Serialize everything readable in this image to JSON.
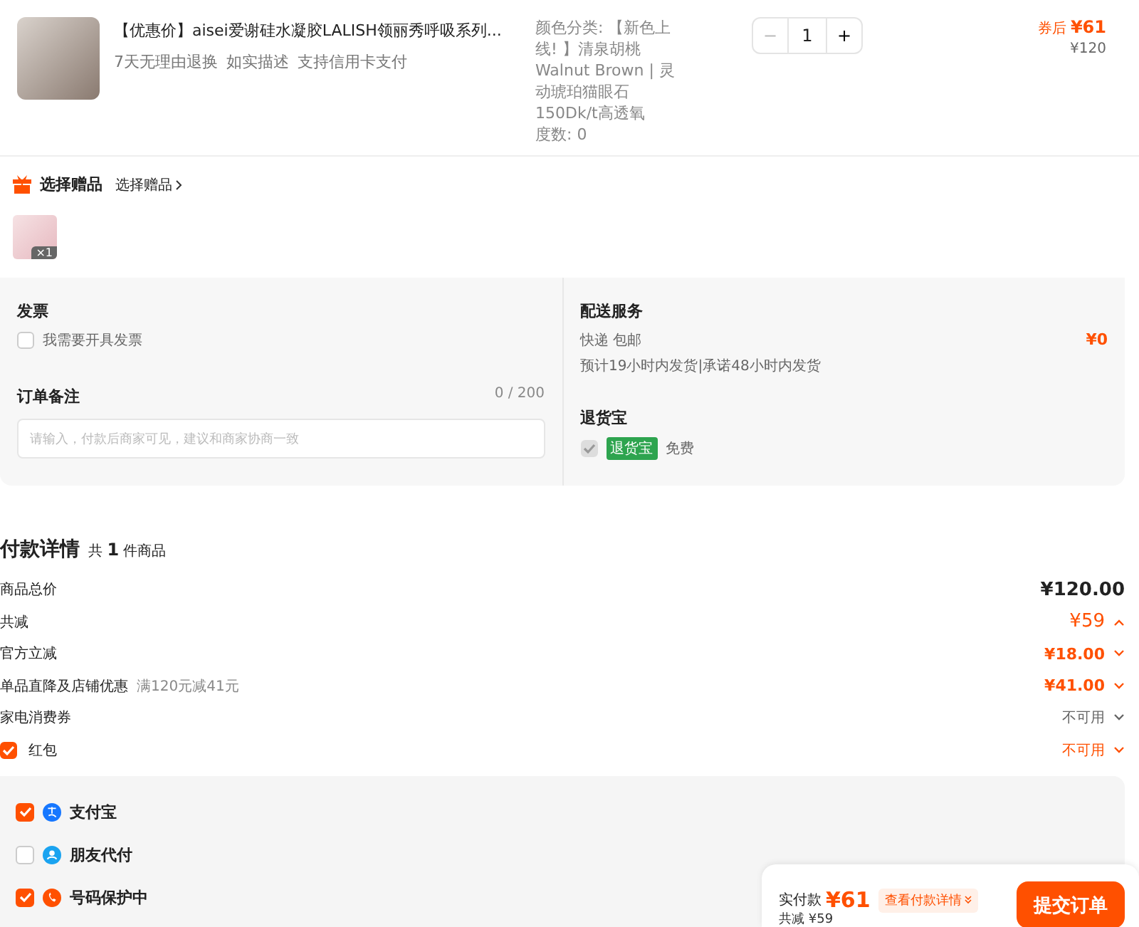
{
  "order_item": {
    "title": "【优惠价】aisei爱谢硅水凝胶LALISH领丽秀呼吸系列...",
    "badges": [
      "7天无理由退换",
      "如实描述",
      "支持信用卡支付"
    ],
    "spec": "颜色分类: 【新色上线! 】清泉胡桃Walnut Brown | 灵动琥珀猫眼石150Dk/t高透氧",
    "degree": "度数: 0",
    "decrement": "−",
    "quantity": "1",
    "increment": "+",
    "price_label": "券后",
    "price": "¥61",
    "original_price": "¥120"
  },
  "gift": {
    "title": "选择赠品",
    "link": "选择赠品",
    "count": "×1"
  },
  "invoice": {
    "title": "发票",
    "option": "我需要开具发票",
    "checked": false
  },
  "note": {
    "title": "订单备注",
    "counter": "0 / 200",
    "placeholder": "请输入，付款后商家可见，建议和商家协商一致"
  },
  "delivery": {
    "title": "配送服务",
    "method": "快递 包邮",
    "eta": "预计19小时内发货|承诺48小时内发货",
    "price": "¥0"
  },
  "return_insurance": {
    "title": "退货宝",
    "checked": true,
    "disabled": true,
    "tag": "退货宝",
    "note": "免费"
  },
  "payment_details": {
    "title": "付款详情",
    "summary": "共 **1** 件商品",
    "rows": [
      {
        "kind": "total",
        "label": "商品总价",
        "value": "¥120.00"
      },
      {
        "kind": "discount_total",
        "label": "共减",
        "value": "¥59",
        "expanded": true
      },
      {
        "kind": "discount",
        "label": "官方立减",
        "value": "¥18.00",
        "expanded": false
      },
      {
        "kind": "discount",
        "label": "单品直降及店铺优惠",
        "note": "满120元减41元",
        "value": "¥41.00",
        "expanded": false
      },
      {
        "kind": "unavailable",
        "label": "家电消费券",
        "value": "不可用",
        "expanded": false
      },
      {
        "kind": "checkbox",
        "label": "红包",
        "checked": true,
        "value": "不可用",
        "expanded": false
      }
    ]
  },
  "pay_options": [
    {
      "kind": "wallet",
      "label": "支付宝",
      "checked": true
    },
    {
      "kind": "friend",
      "label": "朋友代付",
      "checked": false
    },
    {
      "kind": "privacy",
      "label": "号码保护中",
      "checked": true
    }
  ],
  "checkout": {
    "label": "实付款",
    "amount": "¥61",
    "details_link": "查看付款详情",
    "submit": "提交订单",
    "discount": "共减 ¥59"
  }
}
